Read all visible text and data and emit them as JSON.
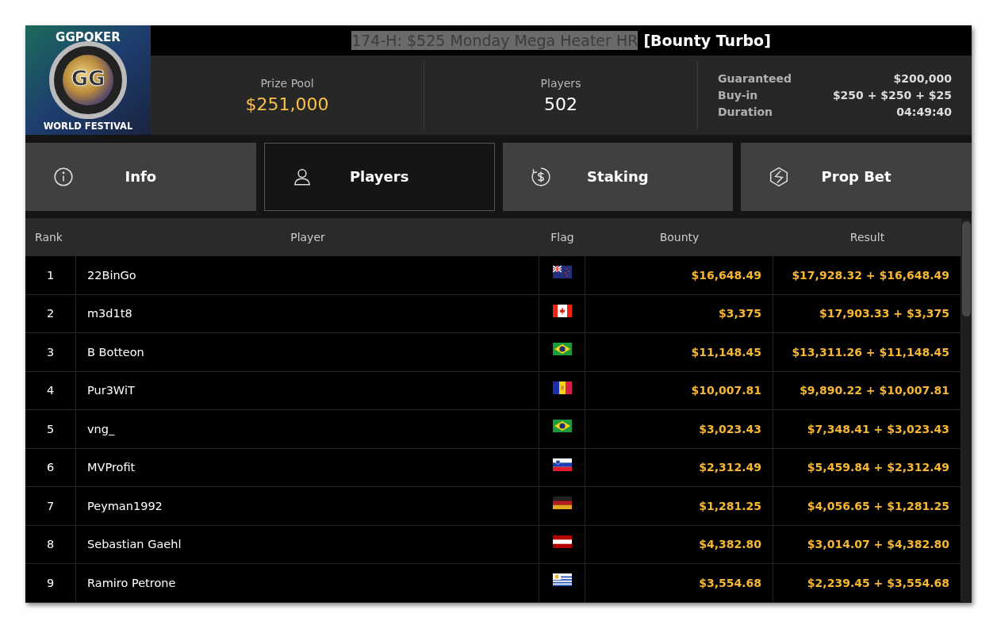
{
  "logo": {
    "top": "GGPOKER",
    "center": "GG",
    "bottom": "WORLD FESTIVAL"
  },
  "title_parts": [
    {
      "text": "174-H: $525 Monday Mega Heater HR",
      "selected": true
    },
    {
      "text": "[Bounty Turbo]",
      "selected": false
    }
  ],
  "prize_pool": {
    "label": "Prize Pool",
    "value": "$251,000"
  },
  "players_count": {
    "label": "Players",
    "value": "502"
  },
  "details": [
    {
      "label": "Guaranteed",
      "value": "$200,000"
    },
    {
      "label": "Buy-in",
      "value": "$250 + $250 + $25"
    },
    {
      "label": "Duration",
      "value": "04:49:40"
    }
  ],
  "tabs": [
    {
      "label": "Info",
      "kind": "info",
      "selected": false
    },
    {
      "label": "Players",
      "kind": "user",
      "selected": true
    },
    {
      "label": "Staking",
      "kind": "dollar",
      "selected": false
    },
    {
      "label": "Prop Bet",
      "kind": "prop",
      "selected": false
    }
  ],
  "table": {
    "columns": [
      "Rank",
      "Player",
      "Flag",
      "Bounty",
      "Result"
    ],
    "rows": [
      {
        "rank": "1",
        "player": "22BinGo",
        "kind": "nz",
        "bounty": "$16,648.49",
        "result": "$17,928.32 + $16,648.49"
      },
      {
        "rank": "2",
        "player": "m3d1t8",
        "kind": "ca",
        "bounty": "$3,375",
        "result": "$17,903.33 + $3,375"
      },
      {
        "rank": "3",
        "player": "B Botteon",
        "kind": "br",
        "bounty": "$11,148.45",
        "result": "$13,311.26 + $11,148.45"
      },
      {
        "rank": "4",
        "player": "Pur3WiT",
        "kind": "ad",
        "bounty": "$10,007.81",
        "result": "$9,890.22 + $10,007.81"
      },
      {
        "rank": "5",
        "player": "vng_",
        "kind": "br",
        "bounty": "$3,023.43",
        "result": "$7,348.41 + $3,023.43"
      },
      {
        "rank": "6",
        "player": "MVProfit",
        "kind": "si",
        "bounty": "$2,312.49",
        "result": "$5,459.84 + $2,312.49"
      },
      {
        "rank": "7",
        "player": "Peyman1992",
        "kind": "de",
        "bounty": "$1,281.25",
        "result": "$4,056.65 + $1,281.25"
      },
      {
        "rank": "8",
        "player": "Sebastian Gaehl",
        "kind": "at",
        "bounty": "$4,382.80",
        "result": "$3,014.07 + $4,382.80"
      },
      {
        "rank": "9",
        "player": "Ramiro Petrone",
        "kind": "uy",
        "bounty": "$3,554.68",
        "result": "$2,239.45 + $3,554.68"
      }
    ]
  }
}
